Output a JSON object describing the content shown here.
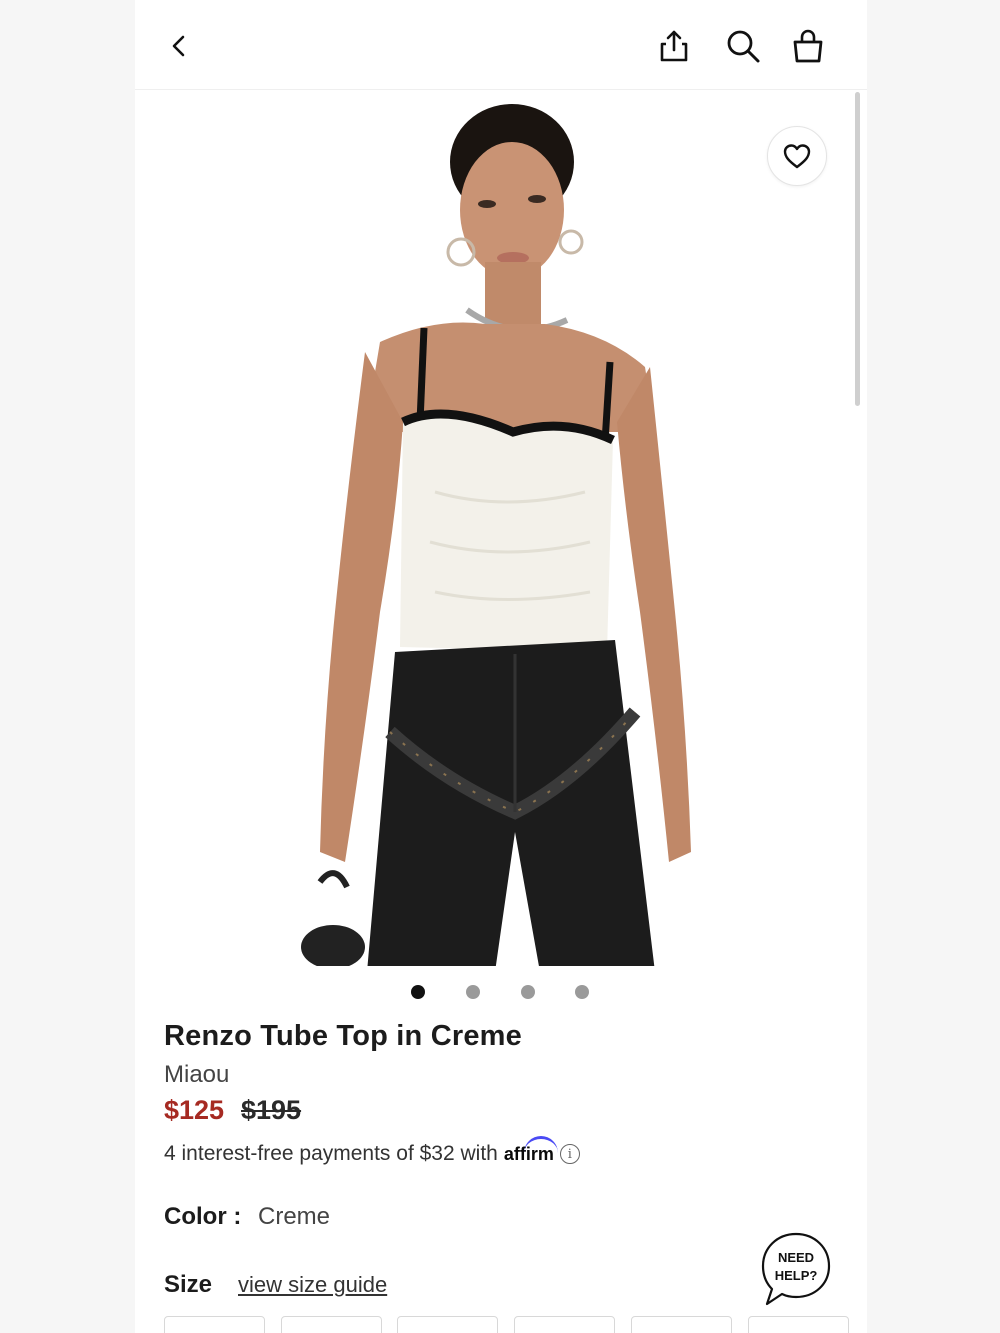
{
  "nav": {
    "back_icon": "chevron-left-icon",
    "share_icon": "share-icon",
    "search_icon": "search-icon",
    "bag_icon": "shopping-bag-icon"
  },
  "gallery": {
    "image_count": 4,
    "active_index": 0,
    "wishlist_icon": "heart-icon"
  },
  "product": {
    "title": "Renzo Tube Top in Creme",
    "brand": "Miaou",
    "price_sale": "$125",
    "price_original": "$195",
    "installments_text": "4 interest-free payments of $32 with",
    "affirm_logo": "affirm",
    "info_icon_glyph": "i"
  },
  "color": {
    "label": "Color",
    "value": "Creme"
  },
  "size": {
    "label": "Size",
    "guide_link": "view size guide",
    "option_count": 6
  },
  "help": {
    "line1": "NEED",
    "line2": "HELP?"
  },
  "colors": {
    "sale_price": "#a62a22",
    "affirm_blue": "#4a4af4",
    "text_dark": "#1c1c1c"
  }
}
